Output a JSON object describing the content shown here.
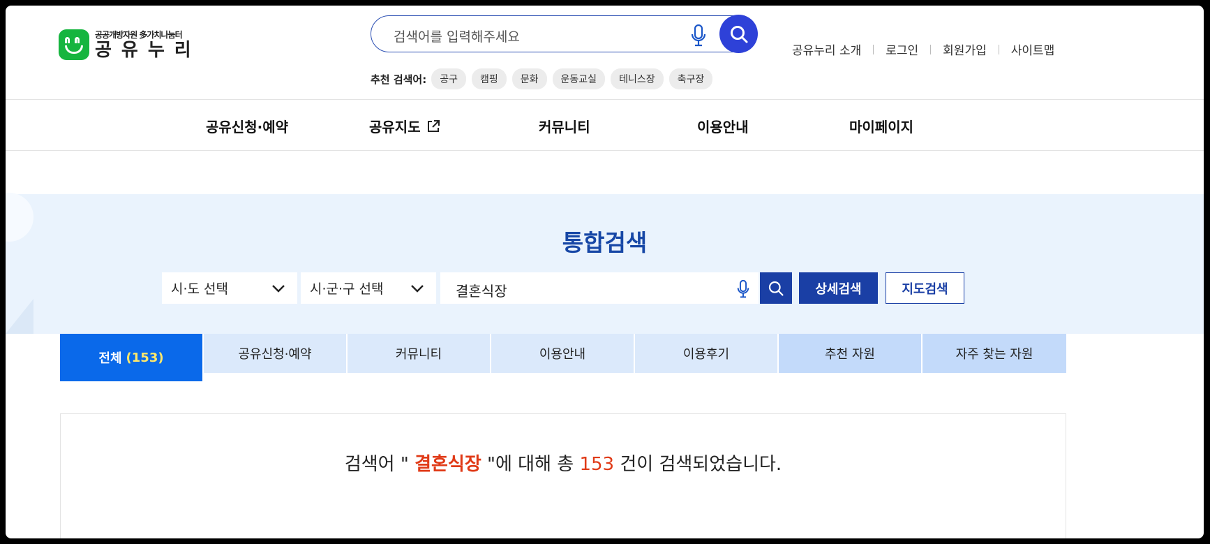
{
  "logo": {
    "sub": "공공개방자원 多가치나눔터",
    "main": "공유누리"
  },
  "top_search": {
    "placeholder": "검색어를 입력해주세요"
  },
  "recommend": {
    "label": "추천 검색어:",
    "tags": [
      "공구",
      "캠핑",
      "문화",
      "운동교실",
      "테니스장",
      "축구장"
    ]
  },
  "util_links": [
    "공유누리 소개",
    "로그인",
    "회원가입",
    "사이트맵"
  ],
  "gnb": [
    "공유신청·예약",
    "공유지도",
    "커뮤니티",
    "이용안내",
    "마이페이지"
  ],
  "search": {
    "title": "통합검색",
    "sido": "시·도 선택",
    "sigungu": "시·군·구 선택",
    "query": "결혼식장",
    "detail_button": "상세검색",
    "map_button": "지도검색"
  },
  "tabs": [
    {
      "label": "전체",
      "count": "(153)"
    },
    {
      "label": "공유신청·예약"
    },
    {
      "label": "커뮤니티"
    },
    {
      "label": "이용안내"
    },
    {
      "label": "이용후기"
    },
    {
      "label": "추천 자원"
    },
    {
      "label": "자주 찾는 자원"
    }
  ],
  "result": {
    "prefix": "검색어 \"",
    "keyword": "결혼식장",
    "middle": "\"에 대해 총",
    "count": "153",
    "suffix": "건이 검색되었습니다."
  },
  "colors": {
    "brand_green": "#16b53f",
    "primary_blue": "#1a3fa5",
    "active_tab": "#0a69ea",
    "highlight_red": "#e03a17"
  }
}
